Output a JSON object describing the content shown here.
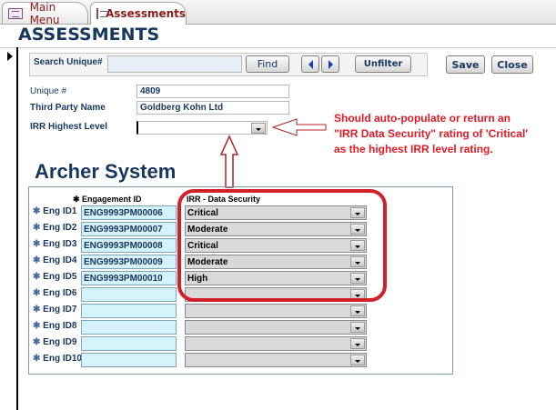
{
  "tabs": [
    {
      "label": "Main Menu",
      "active": false
    },
    {
      "label": "Assessments",
      "active": true
    }
  ],
  "title": "ASSESSMENTS",
  "search": {
    "label": "Search Unique#",
    "value": "",
    "find": "Find",
    "unfilter": "Unfilter"
  },
  "actions": {
    "save": "Save",
    "close": "Close"
  },
  "fields": {
    "unique_label": "Unique #",
    "unique_value": "4809",
    "party_label": "Third Party Name",
    "party_value": "Goldberg Kohn Ltd",
    "irr_label": "IRR Highest Level",
    "irr_value": ""
  },
  "annotation": "Should auto-populate or return an \"IRR Data Security\" rating of 'Critical' as the highest IRR level rating.",
  "section_title": "Archer System",
  "subform": {
    "col_id": "Engagement ID",
    "col_irr": "IRR - Data Security",
    "rows": [
      {
        "label": "Eng ID1",
        "id": "ENG9993PM00006",
        "irr": "Critical"
      },
      {
        "label": "Eng ID2",
        "id": "ENG9993PM00007",
        "irr": "Moderate"
      },
      {
        "label": "Eng ID3",
        "id": "ENG9993PM00008",
        "irr": "Critical"
      },
      {
        "label": "Eng ID4",
        "id": "ENG9993PM00009",
        "irr": "Moderate"
      },
      {
        "label": "Eng ID5",
        "id": "ENG9993PM00010",
        "irr": "High"
      },
      {
        "label": "Eng ID6",
        "id": "",
        "irr": ""
      },
      {
        "label": "Eng ID7",
        "id": "",
        "irr": ""
      },
      {
        "label": "Eng ID8",
        "id": "",
        "irr": ""
      },
      {
        "label": "Eng ID9",
        "id": "",
        "irr": ""
      },
      {
        "label": "Eng ID10",
        "id": "",
        "irr": ""
      }
    ]
  },
  "colors": {
    "annotation": "#e01b24",
    "heading": "#17375e"
  }
}
